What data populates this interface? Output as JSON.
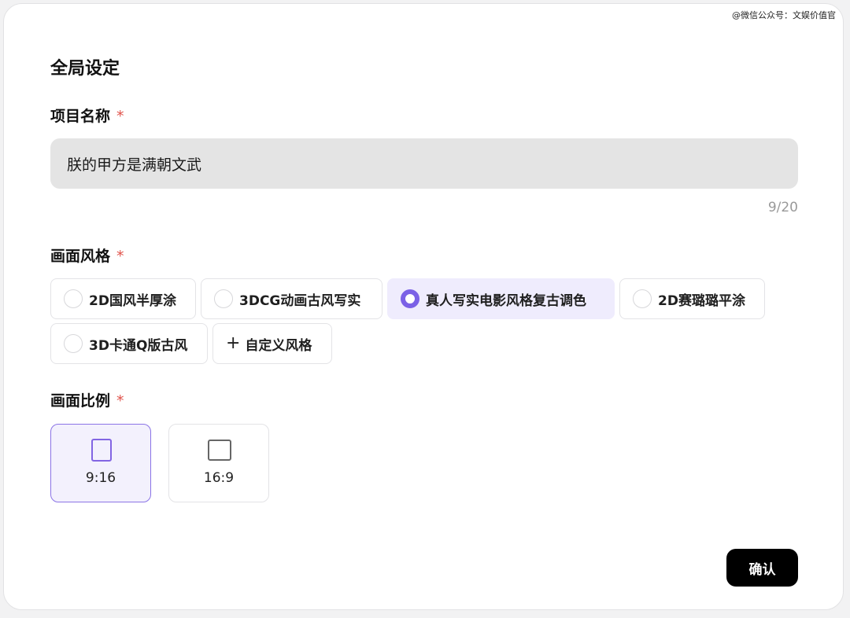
{
  "watermark": "@微信公众号：文娱价值官",
  "dialog": {
    "title": "全局设定",
    "required_mark": "*"
  },
  "project_name": {
    "label": "项目名称",
    "value": "朕的甲方是满朝文武",
    "counter": "9/20"
  },
  "style": {
    "label": "画面风格",
    "options": [
      {
        "label": "2D国风半厚涂",
        "selected": false
      },
      {
        "label": "3DCG动画古风写实",
        "selected": false
      },
      {
        "label": "真人写实电影风格复古调色",
        "selected": true
      },
      {
        "label": "2D赛璐璐平涂",
        "selected": false
      },
      {
        "label": "3D卡通Q版古风",
        "selected": false
      }
    ],
    "custom_label": "自定义风格",
    "custom_icon": "plus-icon"
  },
  "ratio": {
    "label": "画面比例",
    "options": [
      {
        "label": "9:16",
        "selected": true,
        "icon": "portrait-frame-icon"
      },
      {
        "label": "16:9",
        "selected": false,
        "icon": "landscape-frame-icon"
      }
    ]
  },
  "footer": {
    "confirm_label": "确认"
  },
  "colors": {
    "accent": "#7b61e6",
    "required": "#e0524a",
    "button": "#000000"
  }
}
